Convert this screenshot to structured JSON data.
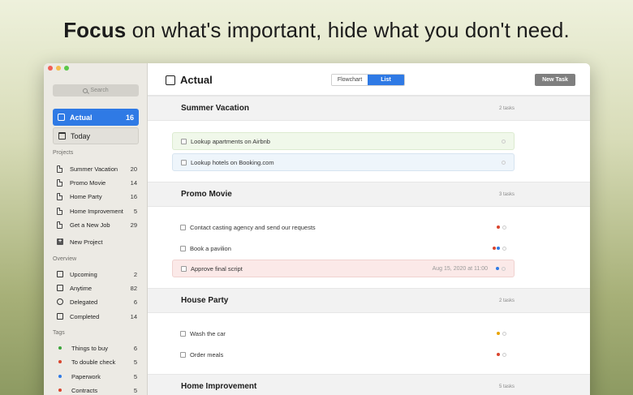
{
  "headline": {
    "bold": "Focus",
    "rest": " on what's important, hide what you don't need."
  },
  "sidebar": {
    "search_placeholder": "Search",
    "actual": {
      "label": "Actual",
      "count": "16"
    },
    "today": {
      "label": "Today"
    },
    "projects_title": "Projects",
    "projects": [
      {
        "label": "Summer Vacation",
        "count": "20"
      },
      {
        "label": "Promo Movie",
        "count": "14"
      },
      {
        "label": "Home Party",
        "count": "16"
      },
      {
        "label": "Home Improvement",
        "count": "5"
      },
      {
        "label": "Get a New Job",
        "count": "29"
      }
    ],
    "new_project": "New Project",
    "overview_title": "Overview",
    "overview": [
      {
        "label": "Upcoming",
        "count": "2"
      },
      {
        "label": "Anytime",
        "count": "82"
      },
      {
        "label": "Delegated",
        "count": "6"
      },
      {
        "label": "Completed",
        "count": "14"
      }
    ],
    "tags_title": "Tags",
    "tags": [
      {
        "label": "Things to buy",
        "count": "6",
        "color": "#3aa53a"
      },
      {
        "label": "To double check",
        "count": "5",
        "color": "#d9452e"
      },
      {
        "label": "Paperwork",
        "count": "5",
        "color": "#2f7ae5"
      },
      {
        "label": "Contracts",
        "count": "5",
        "color": "#d9452e"
      }
    ]
  },
  "toolbar": {
    "title": "Actual",
    "seg_flowchart": "Flowchart",
    "seg_list": "List",
    "new_task": "New Task"
  },
  "groups": [
    {
      "name": "Summer Vacation",
      "count": "2 tasks",
      "tasks": [
        {
          "text": "Lookup apartments on Airbnb",
          "bg": "green"
        },
        {
          "text": "Lookup hotels on Booking.com",
          "bg": "blue"
        }
      ]
    },
    {
      "name": "Promo Movie",
      "count": "3 tasks",
      "tasks": [
        {
          "text": "Contact casting agency and send our requests",
          "dots": [
            "#d9452e"
          ]
        },
        {
          "text": "Book a pavilion",
          "dots": [
            "#d9452e",
            "#2f7ae5"
          ]
        },
        {
          "text": "Approve final script",
          "date": "Aug 15, 2020 at 11:00",
          "bg": "red",
          "dots": [
            "#2f7ae5"
          ]
        }
      ]
    },
    {
      "name": "House Party",
      "count": "2 tasks",
      "tasks": [
        {
          "text": "Wash the car",
          "dots": [
            "#e8a400"
          ]
        },
        {
          "text": "Order meals",
          "dots": [
            "#d9452e"
          ]
        }
      ]
    },
    {
      "name": "Home Improvement",
      "count": "5 tasks",
      "tasks": []
    }
  ]
}
